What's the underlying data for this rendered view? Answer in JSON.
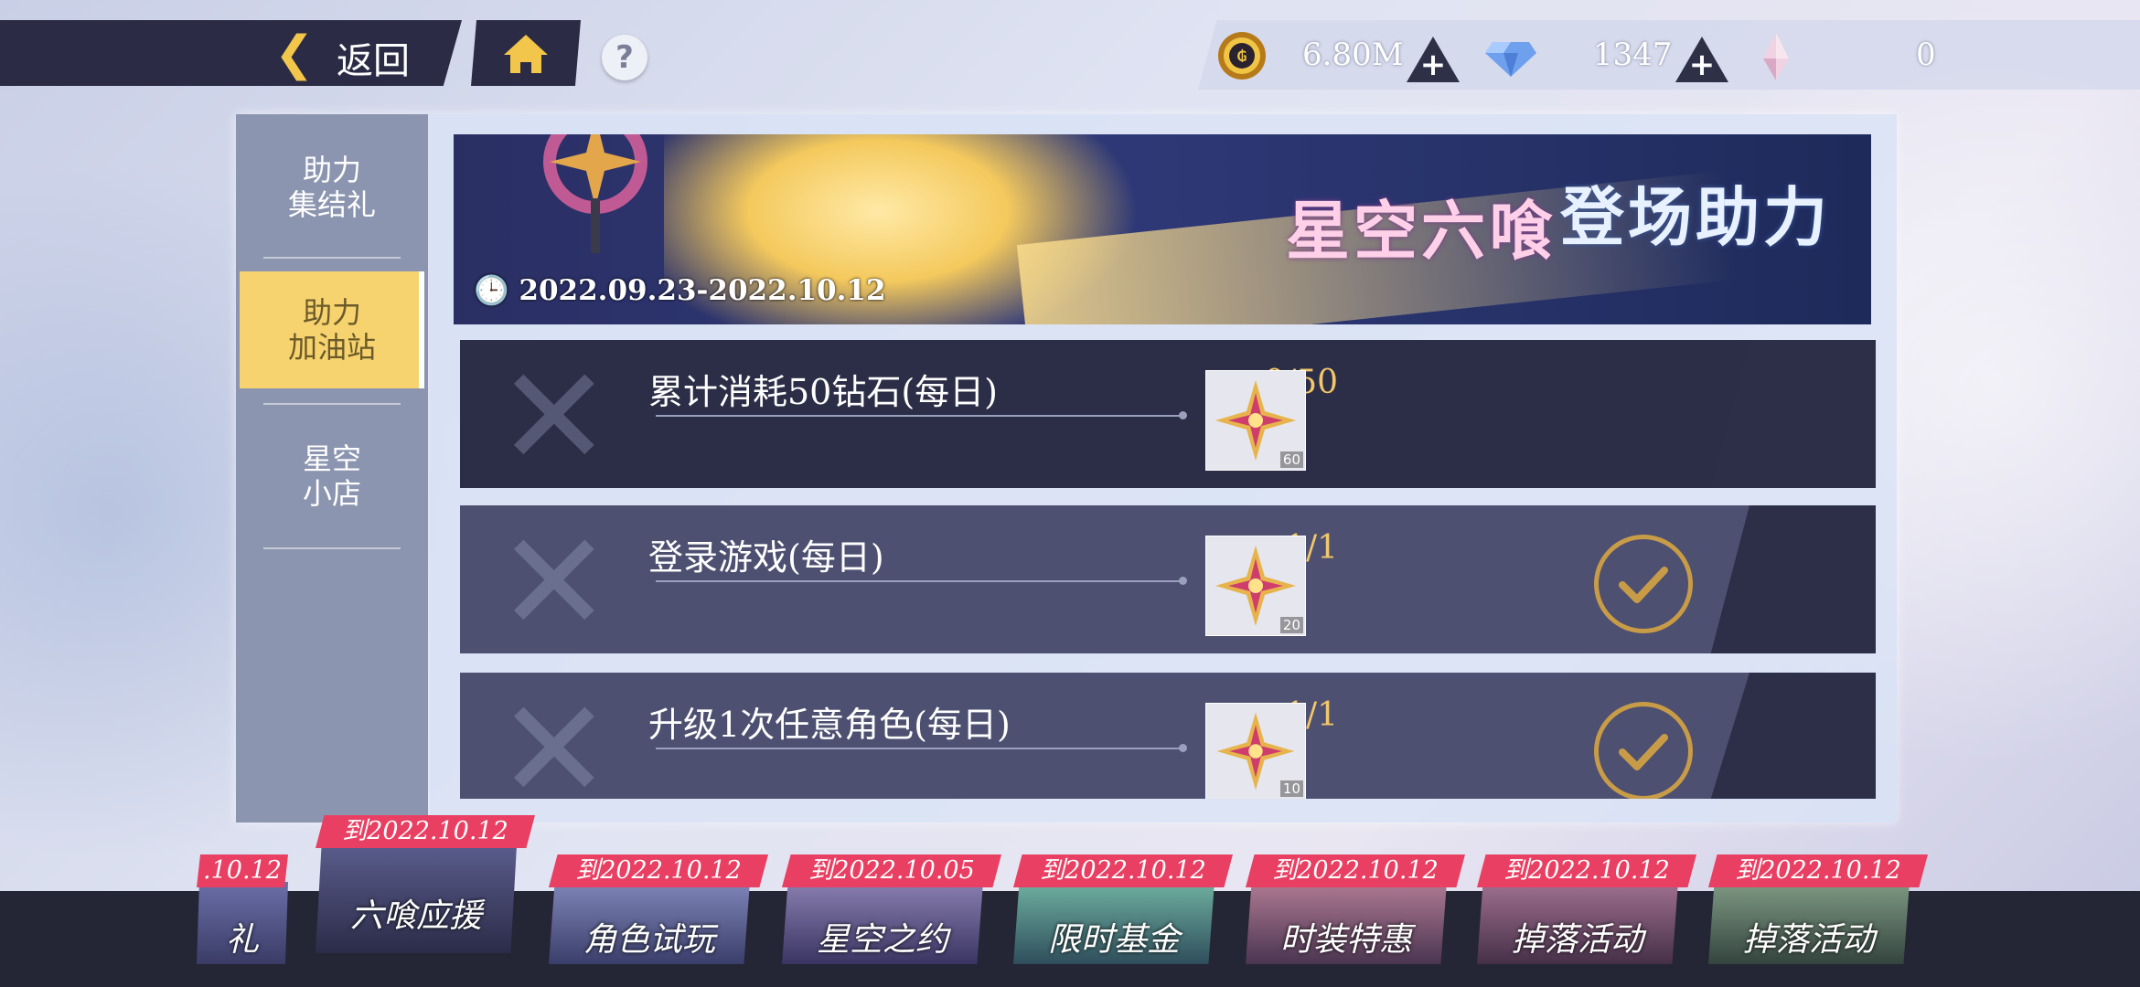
{
  "topbar": {
    "back_label": "返回",
    "back_icon": "chevron-left-icon",
    "home_icon": "home-icon",
    "help_label": "?"
  },
  "resources": {
    "gold": "6.80M",
    "diamonds": "1347",
    "crystals": "0"
  },
  "sidebar": {
    "items": [
      {
        "label_line1": "助力",
        "label_line2": "集结礼",
        "active": false
      },
      {
        "label_line1": "助力",
        "label_line2": "加油站",
        "active": true
      },
      {
        "label_line1": "星空",
        "label_line2": "小店",
        "active": false
      }
    ]
  },
  "banner": {
    "title_part1": "星空六喰",
    "title_part2": "登场助力",
    "date_range": "2022.09.23-2022.10.12"
  },
  "tasks": [
    {
      "name": "累计消耗50钻石(每日)",
      "progress": "0/50",
      "reward_count": "60",
      "completed": false
    },
    {
      "name": "登录游戏(每日)",
      "progress": "1/1",
      "reward_count": "20",
      "completed": true
    },
    {
      "name": "升级1次任意角色(每日)",
      "progress": "1/1",
      "reward_count": "10",
      "completed": true
    }
  ],
  "bottom_tabs": [
    {
      "ribbon": ".10.12",
      "label": "礼"
    },
    {
      "ribbon": "到2022.10.12",
      "label": "六喰应援",
      "active": true
    },
    {
      "ribbon": "到2022.10.12",
      "label": "角色试玩"
    },
    {
      "ribbon": "到2022.10.05",
      "label": "星空之约"
    },
    {
      "ribbon": "到2022.10.12",
      "label": "限时基金"
    },
    {
      "ribbon": "到2022.10.12",
      "label": "时装特惠"
    },
    {
      "ribbon": "到2022.10.12",
      "label": "掉落活动"
    },
    {
      "ribbon": "到2022.10.12",
      "label": "掉落活动"
    }
  ],
  "colors": {
    "accent_gold": "#f2c76a",
    "active_tab_yellow": "#f6d36e",
    "ribbon_red": "#e83f62",
    "panel_dark": "#2d2e48"
  }
}
